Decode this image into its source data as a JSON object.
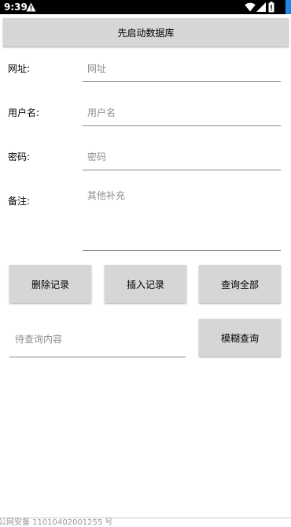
{
  "status_bar": {
    "time": "9:39",
    "icons": [
      "warning-icon",
      "wifi-icon",
      "cell-signal-icon",
      "battery-icon"
    ]
  },
  "top_button": {
    "label": "先启动数据库"
  },
  "form": {
    "url": {
      "label": "网址:",
      "placeholder": "网址"
    },
    "username": {
      "label": "用户名:",
      "placeholder": "用户名"
    },
    "password": {
      "label": "密码:",
      "placeholder": "密码"
    },
    "note": {
      "label": "备注:",
      "placeholder": "其他补充"
    }
  },
  "actions": {
    "delete_label": "删除记录",
    "insert_label": "插入记录",
    "query_all_label": "查询全部"
  },
  "search": {
    "placeholder": "待查询内容",
    "fuzzy_label": "模糊查询"
  },
  "footer": {
    "text": "公网安备 11010402001255 号"
  },
  "colors": {
    "button_bg": "#d6d6d6",
    "status_bar_bg": "#000000",
    "accent_strip": "#1e88e5"
  }
}
